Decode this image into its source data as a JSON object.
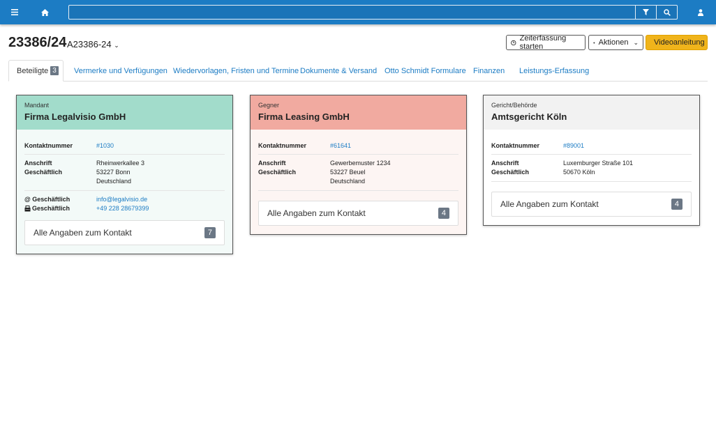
{
  "topbar": {
    "menu_icon": "hamburger-icon",
    "home_icon": "home-icon",
    "search_placeholder": "",
    "filter_icon": "filter-icon",
    "search_icon": "search-icon",
    "user_icon": "user-icon"
  },
  "header": {
    "title": "23386/24",
    "subtitle": "A23386-24",
    "buttons": {
      "time": "Zeiterfassung starten",
      "actions": "Aktionen",
      "video": "Videoanleitung"
    }
  },
  "tabs": [
    {
      "label": "Beteiligte",
      "badge": "3"
    },
    {
      "label": "Vermerke und Verfügungen"
    },
    {
      "label": "Wiedervorlagen, Fristen und Termine"
    },
    {
      "label": "Dokumente & Versand"
    },
    {
      "label": "Otto Schmidt Formulare"
    },
    {
      "label": "Finanzen"
    },
    {
      "label": "Leistungs-Erfassung"
    }
  ],
  "cards": [
    {
      "role": "Mandant",
      "name": "Firma Legalvisio GmbH",
      "color": "#a2dccb",
      "contact_label": "Kontaktnummer",
      "contact": "#1030",
      "address_label1": "Anschrift",
      "address_label2": "Geschäftlich",
      "address1": "Rheinwerkallee 3",
      "address2": "53227 Bonn",
      "address3": "Deutschland",
      "email_label": "@ Geschäftlich",
      "email": "info@legalvisio.de",
      "phone_label": "Geschäftlich",
      "phone": "+49 228 28679399",
      "more_label": "Alle Angaben zum Kontakt",
      "more_count": "7"
    },
    {
      "role": "Gegner",
      "name": "Firma Leasing GmbH",
      "color": "#f1aaa0",
      "contact_label": "Kontaktnummer",
      "contact": "#61641",
      "address_label1": "Anschrift",
      "address_label2": "Geschäftlich",
      "address1": "Gewerbemuster 1234",
      "address2": "53227 Beuel",
      "address3": "Deutschland",
      "more_label": "Alle Angaben zum Kontakt",
      "more_count": "4"
    },
    {
      "role": "Gericht/Behörde",
      "name": "Amtsgericht Köln",
      "color": "#f2f2f2",
      "contact_label": "Kontaktnummer",
      "contact": "#89001",
      "address_label1": "Anschrift",
      "address_label2": "Geschäftlich",
      "address1": "Luxemburger Straße 101",
      "address2": "50670 Köln",
      "more_label": "Alle Angaben zum Kontakt",
      "more_count": "4"
    }
  ]
}
